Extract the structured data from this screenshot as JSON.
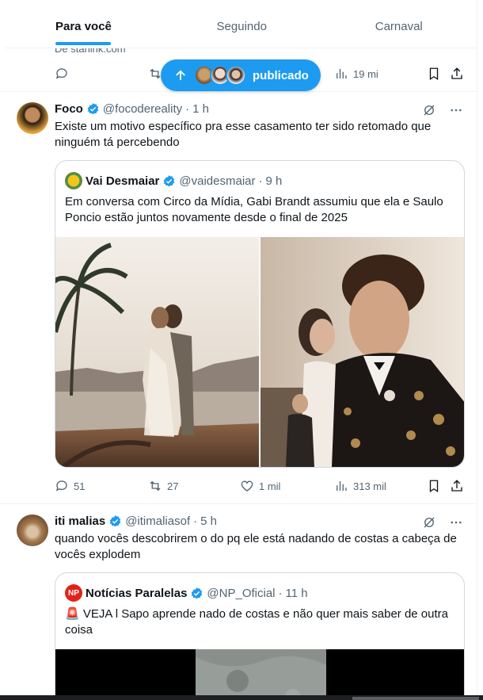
{
  "tabs": [
    {
      "label": "Para você",
      "active": true
    },
    {
      "label": "Seguindo",
      "active": false
    },
    {
      "label": "Carnaval",
      "active": false
    }
  ],
  "partial_tweet": {
    "source_text": "De starlink.com",
    "views": "19 mi"
  },
  "new_posts_pill": {
    "label": "publicado"
  },
  "tweets": [
    {
      "name": "Foco",
      "handle": "@focodereality",
      "time": "1 h",
      "text": "Existe um motivo específico pra esse casamento ter sido retomado que ninguém tá percebendo",
      "quote": {
        "name": "Vai Desmaiar",
        "handle": "@vaidesmaiar",
        "time": "9 h",
        "text": "Em conversa com Circo da Mídia, Gabi Brandt assumiu que ela e Saulo Poncio estão juntos novamente desde o final de 2025"
      },
      "replies": "51",
      "reposts": "27",
      "likes": "1 mil",
      "views": "313 mil"
    },
    {
      "name": "iti malias",
      "handle": "@itimaliasof",
      "time": "5 h",
      "text": "quando vocês descobrirem o do pq ele está nadando de costas a cabeça de vocês explodem",
      "quote": {
        "name": "Notícias Paralelas",
        "avatar_text": "NP",
        "handle": "@NP_Oficial",
        "time": "11 h",
        "text": "🚨 VEJA l Sapo aprende nado de costas e não quer mais saber de outra coisa"
      }
    }
  ],
  "separator": "·",
  "colors": {
    "accent": "#1d9bf0",
    "secondary_text": "#536471",
    "border": "#cfd9de",
    "verified": "#1d9bf0"
  }
}
